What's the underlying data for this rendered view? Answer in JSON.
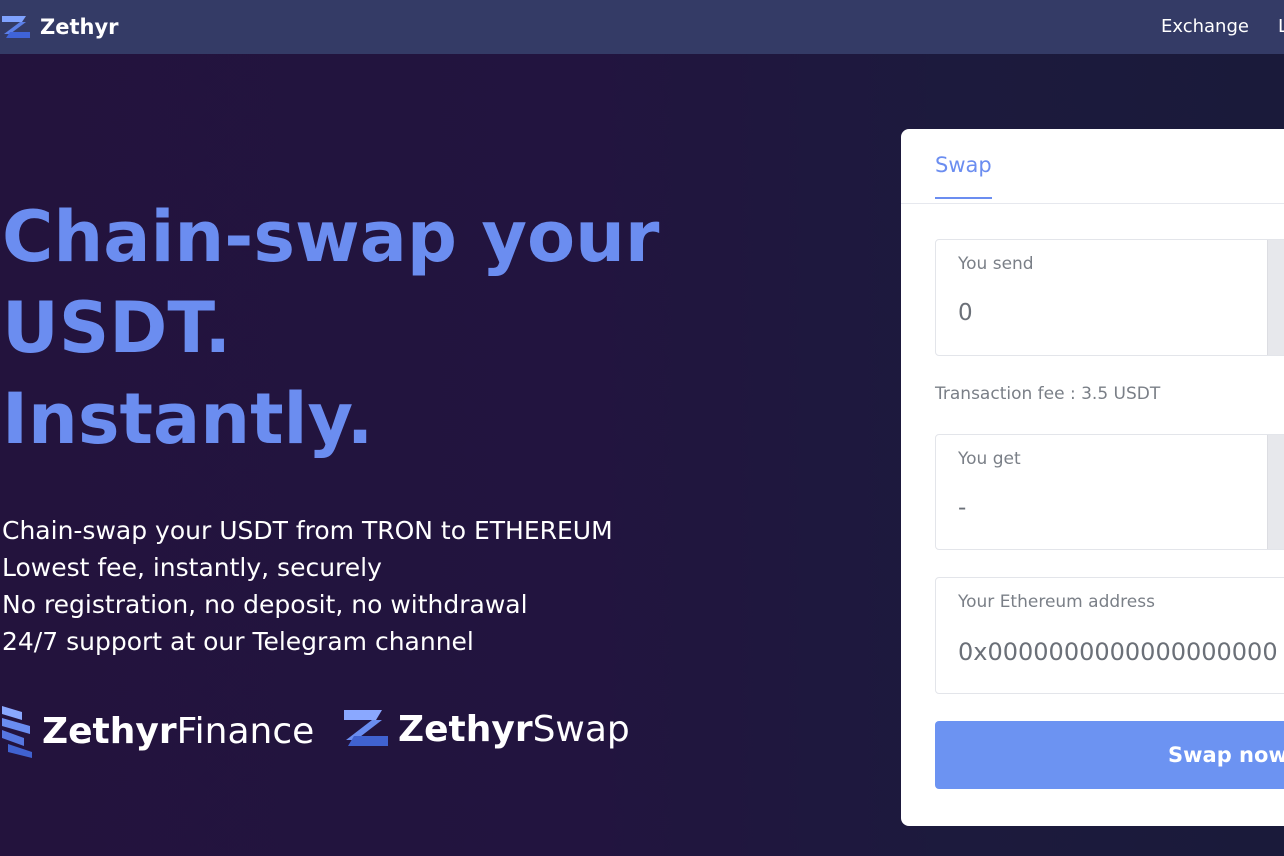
{
  "nav": {
    "brand": "Zethyr",
    "links": [
      "Exchange",
      "L"
    ]
  },
  "hero": {
    "title_lines": [
      "Chain-swap your",
      "USDT.",
      "Instantly."
    ],
    "features": [
      "Chain-swap your USDT from TRON to ETHEREUM",
      "Lowest fee, instantly, securely",
      "No registration, no deposit, no withdrawal",
      "24/7 support at our Telegram channel"
    ]
  },
  "brands": {
    "finance": {
      "bold": "Zethyr",
      "light": "Finance"
    },
    "swap": {
      "bold": "Zethyr",
      "light": "Swap"
    }
  },
  "swap": {
    "tab_label": "Swap",
    "send": {
      "label": "You send",
      "value": "0"
    },
    "fee_text": "Transaction fee : 3.5 USDT",
    "get": {
      "label": "You get",
      "value": "-"
    },
    "address": {
      "label": "Your Ethereum address",
      "placeholder": "0x0000000000000000000"
    },
    "button_label": "Swap now"
  },
  "colors": {
    "accent": "#6b8df0",
    "nav_bg": "#343b66",
    "bg_dark": "#23133d",
    "button": "#6c93f2"
  },
  "icons": {
    "logo": "zethyr-logo-icon"
  }
}
